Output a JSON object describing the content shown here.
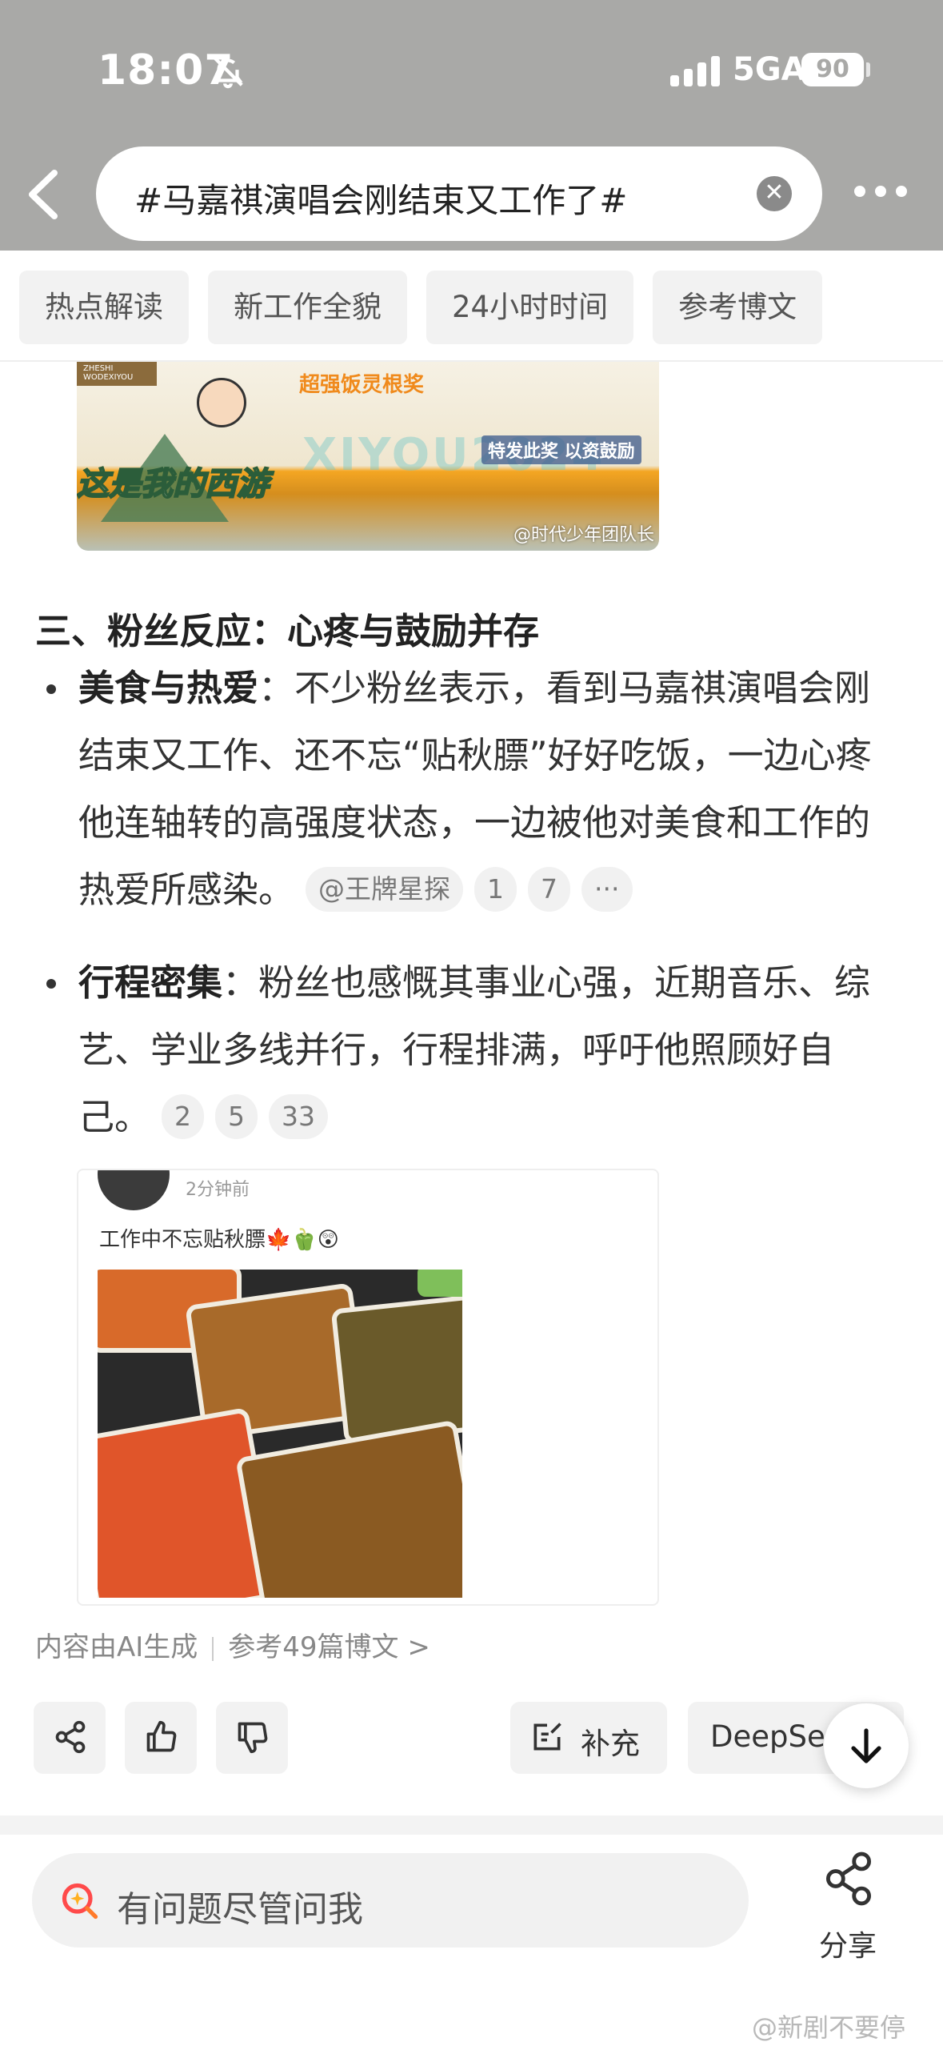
{
  "status_bar": {
    "time": "18:07",
    "network": "5GA",
    "battery": "90"
  },
  "header": {
    "search_query": "#马嘉祺演唱会刚结束又工作了#"
  },
  "tabs": [
    "热点解读",
    "新工作全貌",
    "24小时时间",
    "参考博文"
  ],
  "banner": {
    "sign_text": "ZHESHI WODEXIYOU",
    "title": "超强饭灵根奖",
    "watermark": "XIYOU2024",
    "tag": "特发此奖 以资鼓励",
    "logo": "这是我的西游",
    "credit": "@时代少年团队长"
  },
  "article": {
    "section_title": "三、粉丝反应：心疼与鼓励并存",
    "bullets": [
      {
        "label": "美食与热爱",
        "text": "：不少粉丝表示，看到马嘉祺演唱会刚结束又工作、还不忘“贴秋膘”好好吃饭，一边心疼他连轴转的高强度状态，一边被他对美食和工作的热爱所感染。",
        "chips": [
          "@王牌星探",
          "1",
          "7",
          "···"
        ]
      },
      {
        "label": "行程密集",
        "text": "：粉丝也感慨其事业心强，近期音乐、综艺、学业多线并行，行程排满，呼吁他照顾好自己。",
        "chips": [
          "2",
          "5",
          "33"
        ]
      }
    ]
  },
  "post": {
    "time": "2分钟前",
    "text": "工作中不忘贴秋膘🍁🫑😲"
  },
  "source": {
    "generated": "内容由AI生成",
    "reference": "参考49篇博文 >"
  },
  "actions": {
    "supplement": "补充",
    "deepseek": "DeepSe"
  },
  "bottom_bar": {
    "ask_placeholder": "有问题尽管问我",
    "share": "分享"
  },
  "watermark": "@新剧不要停",
  "colors": {
    "header_bg": "#a9a9a7",
    "accent_search": "#ff4a4a",
    "chip_bg": "#f1f1f1"
  }
}
